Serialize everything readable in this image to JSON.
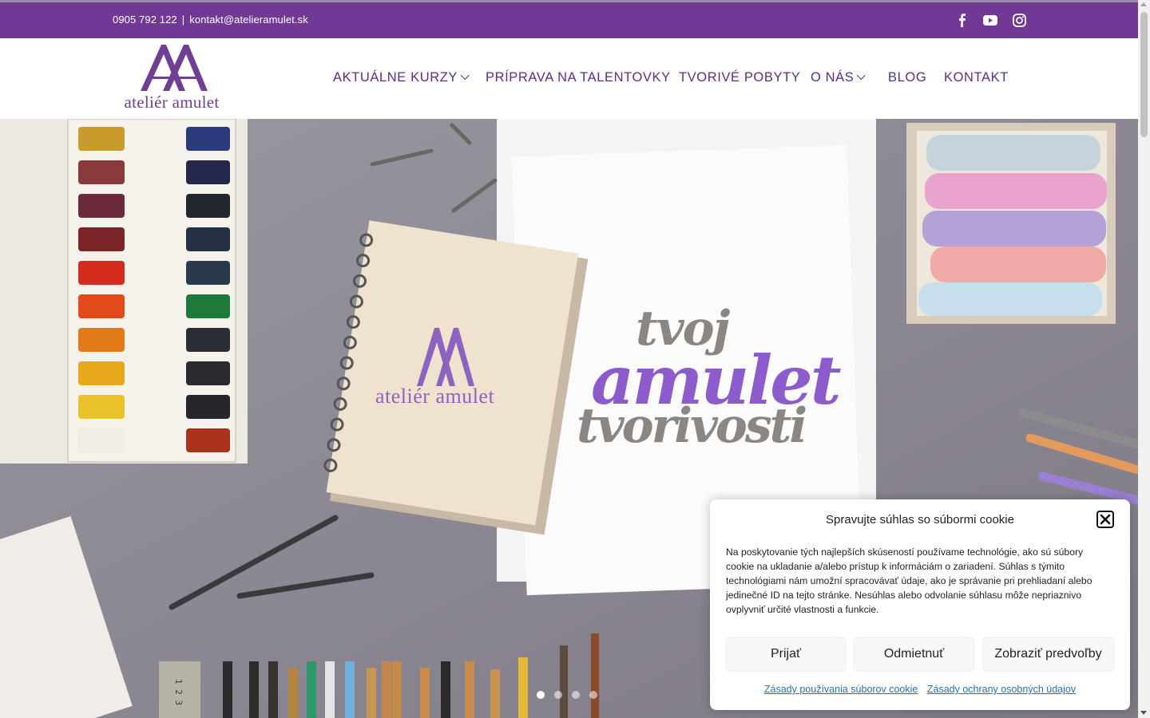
{
  "topbar": {
    "phone": "0905 792 122",
    "separator": "|",
    "email": "kontakt@atelieramulet.sk",
    "social_icons": [
      "facebook-icon",
      "youtube-icon",
      "instagram-icon"
    ],
    "background_color": "#713995"
  },
  "header": {
    "logo_text": "ateliér amulet",
    "nav": [
      {
        "label": "AKTUÁLNE KURZY",
        "has_dropdown": true
      },
      {
        "label": "PRÍPRAVA NA TALENTOVKY",
        "has_dropdown": false
      },
      {
        "label": "TVORIVÉ POBYTY",
        "has_dropdown": false
      },
      {
        "label": "O NÁS",
        "has_dropdown": true
      },
      {
        "label": "BLOG",
        "has_dropdown": false
      },
      {
        "label": "KONTAKT",
        "has_dropdown": false
      }
    ],
    "nav_color": "#5b2e83"
  },
  "hero": {
    "notebook_logo_text": "ateliér amulet",
    "slogan_line1": "tvoj",
    "slogan_line2": "amulet",
    "slogan_line3": "tvorivosti",
    "slider_dots": 4,
    "active_dot": 0,
    "ruler_marks": "1 2 3"
  },
  "cookie_banner": {
    "title": "Spravujte súhlas so súbormi cookie",
    "message": "Na poskytovanie tých najlepších skúseností používame technológie, ako sú súbory cookie na ukladanie a/alebo prístup k informáciám o zariadení. Súhlas s týmito technológiami nám umožní spracovávať údaje, ako je správanie pri prehliadaní alebo jedinečné ID na tejto stránke. Nesúhlas alebo odvolanie súhlasu môže nepriaznivo ovplyvniť určité vlastnosti a funkcie.",
    "accept_label": "Prijať",
    "deny_label": "Odmietnuť",
    "preferences_label": "Zobraziť predvoľby",
    "cookie_policy_link": "Zásady používania súborov cookie",
    "privacy_policy_link": "Zásady ochrany osobných údajov",
    "link_color": "#1e73be"
  }
}
